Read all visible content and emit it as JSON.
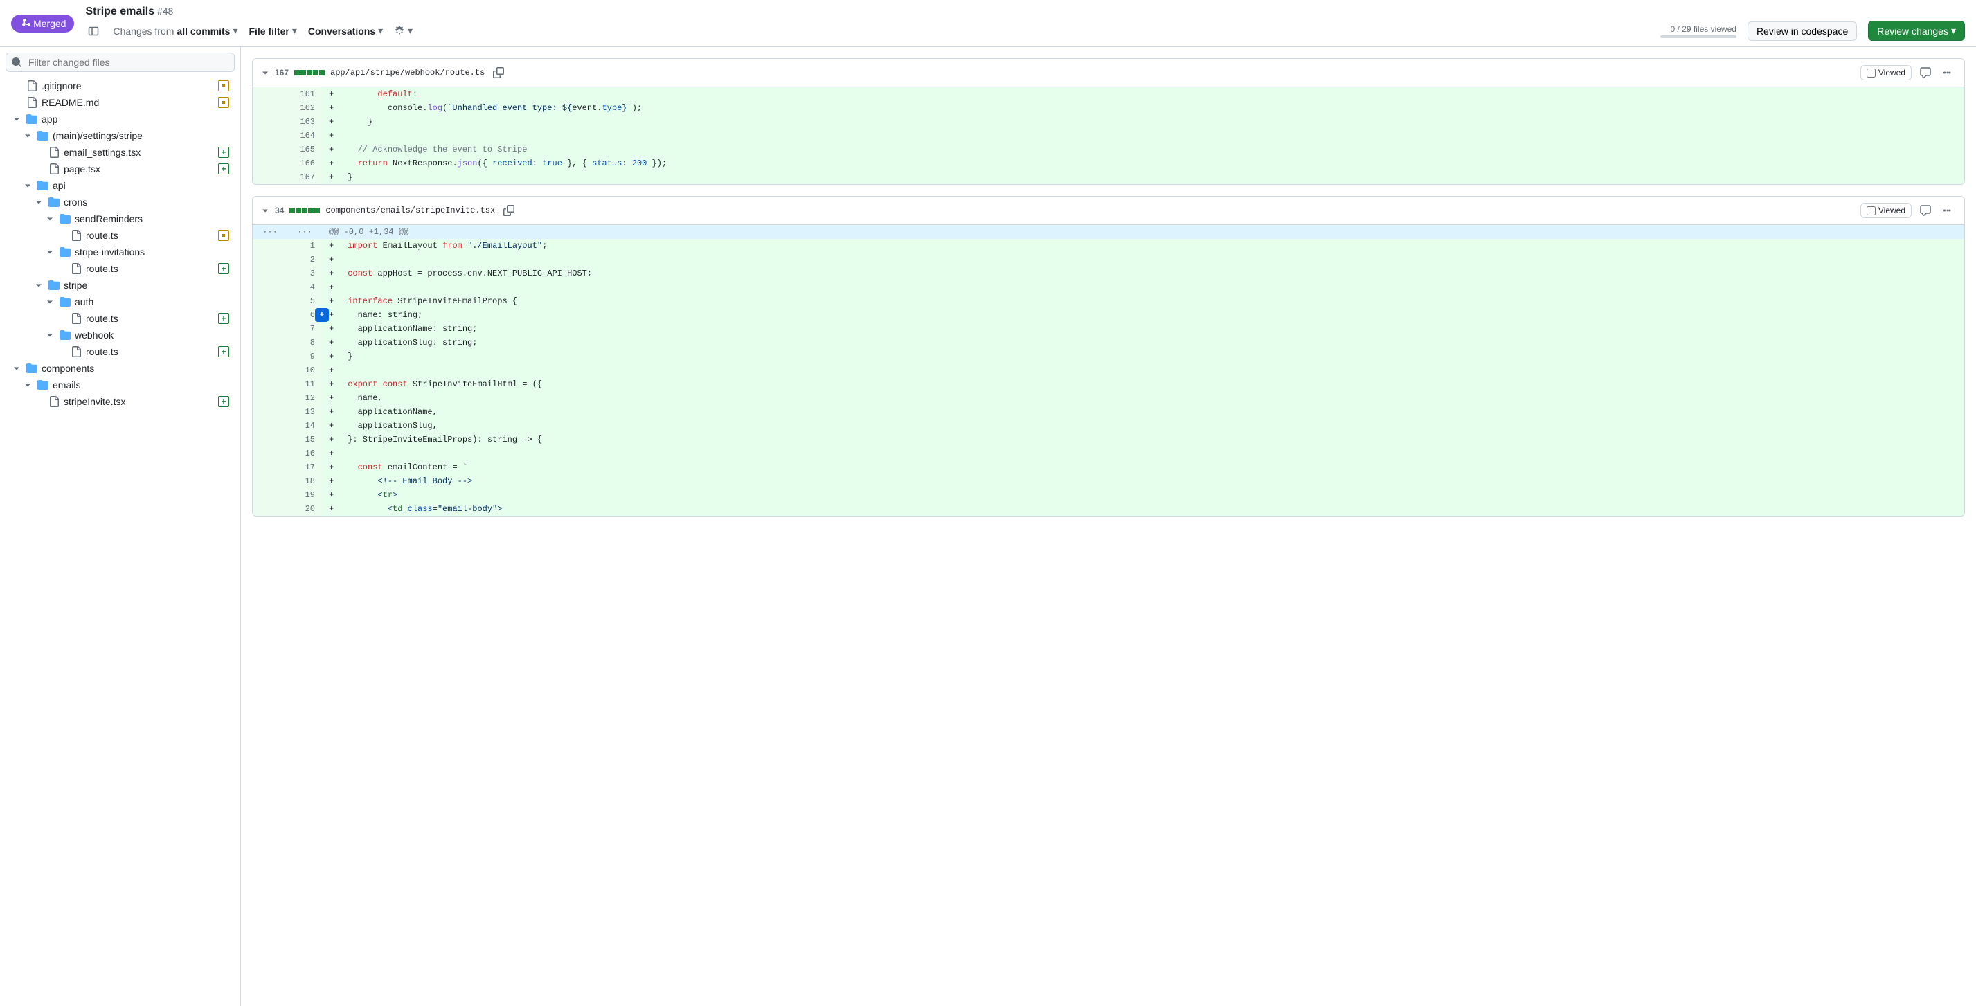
{
  "header": {
    "merged_label": "Merged",
    "pr_title": "Stripe emails",
    "pr_number": "#48",
    "changes_from_prefix": "Changes from",
    "changes_from_value": "all commits",
    "file_filter": "File filter",
    "conversations": "Conversations",
    "files_viewed": "0 / 29 files viewed",
    "review_codespace": "Review in codespace",
    "review_changes": "Review changes"
  },
  "sidebar": {
    "filter_placeholder": "Filter changed files",
    "items": [
      {
        "label": ".gitignore",
        "type": "file",
        "indent": 0,
        "status": "modified"
      },
      {
        "label": "README.md",
        "type": "file",
        "indent": 0,
        "status": "modified"
      },
      {
        "label": "app",
        "type": "folder",
        "indent": 0
      },
      {
        "label": "(main)/settings/stripe",
        "type": "folder",
        "indent": 1
      },
      {
        "label": "email_settings.tsx",
        "type": "file",
        "indent": 2,
        "status": "added"
      },
      {
        "label": "page.tsx",
        "type": "file",
        "indent": 2,
        "status": "added"
      },
      {
        "label": "api",
        "type": "folder",
        "indent": 1
      },
      {
        "label": "crons",
        "type": "folder",
        "indent": 2
      },
      {
        "label": "sendReminders",
        "type": "folder",
        "indent": 3
      },
      {
        "label": "route.ts",
        "type": "file",
        "indent": 4,
        "status": "modified"
      },
      {
        "label": "stripe-invitations",
        "type": "folder",
        "indent": 3
      },
      {
        "label": "route.ts",
        "type": "file",
        "indent": 4,
        "status": "added"
      },
      {
        "label": "stripe",
        "type": "folder",
        "indent": 2
      },
      {
        "label": "auth",
        "type": "folder",
        "indent": 3
      },
      {
        "label": "route.ts",
        "type": "file",
        "indent": 4,
        "status": "added"
      },
      {
        "label": "webhook",
        "type": "folder",
        "indent": 3
      },
      {
        "label": "route.ts",
        "type": "file",
        "indent": 4,
        "status": "added"
      },
      {
        "label": "components",
        "type": "folder",
        "indent": 0
      },
      {
        "label": "emails",
        "type": "folder",
        "indent": 1
      },
      {
        "label": "stripeInvite.tsx",
        "type": "file",
        "indent": 2,
        "status": "added"
      }
    ]
  },
  "files": [
    {
      "change_count": "167",
      "path": "app/api/stripe/webhook/route.ts",
      "viewed_label": "Viewed",
      "lines": [
        {
          "num_new": "161",
          "sign": "+",
          "html": "      <span class=\"syn-kw\">default</span>:"
        },
        {
          "num_new": "162",
          "sign": "+",
          "html": "        console.<span class=\"syn-fn\">log</span>(<span class=\"syn-str\">`Unhandled event type: ${</span>event.<span class=\"syn-prop\">type</span><span class=\"syn-str\">}`</span>);"
        },
        {
          "num_new": "163",
          "sign": "+",
          "html": "    }"
        },
        {
          "num_new": "164",
          "sign": "+",
          "html": ""
        },
        {
          "num_new": "165",
          "sign": "+",
          "html": "  <span class=\"syn-com\">// Acknowledge the event to Stripe</span>"
        },
        {
          "num_new": "166",
          "sign": "+",
          "html": "  <span class=\"syn-kw\">return</span> NextResponse.<span class=\"syn-fn\">json</span>({ <span class=\"syn-prop\">received</span>: <span class=\"syn-num\">true</span> }, { <span class=\"syn-prop\">status</span>: <span class=\"syn-num\">200</span> });"
        },
        {
          "num_new": "167",
          "sign": "+",
          "html": "}"
        }
      ]
    },
    {
      "change_count": "34",
      "path": "components/emails/stripeInvite.tsx",
      "viewed_label": "Viewed",
      "hunk": "@@ -0,0 +1,34 @@",
      "lines": [
        {
          "num_new": "1",
          "sign": "+",
          "html": "<span class=\"syn-kw\">import</span> EmailLayout <span class=\"syn-kw\">from</span> <span class=\"syn-str\">\"./EmailLayout\"</span>;"
        },
        {
          "num_new": "2",
          "sign": "+",
          "html": ""
        },
        {
          "num_new": "3",
          "sign": "+",
          "html": "<span class=\"syn-kw\">const</span> appHost = process.env.NEXT_PUBLIC_API_HOST;"
        },
        {
          "num_new": "4",
          "sign": "+",
          "html": ""
        },
        {
          "num_new": "5",
          "sign": "+",
          "html": "<span class=\"syn-kw\">interface</span> StripeInviteEmailProps {"
        },
        {
          "num_new": "6",
          "sign": "+",
          "html": "  name: string;",
          "hover": true
        },
        {
          "num_new": "7",
          "sign": "+",
          "html": "  applicationName: string;"
        },
        {
          "num_new": "8",
          "sign": "+",
          "html": "  applicationSlug: string;"
        },
        {
          "num_new": "9",
          "sign": "+",
          "html": "}"
        },
        {
          "num_new": "10",
          "sign": "+",
          "html": ""
        },
        {
          "num_new": "11",
          "sign": "+",
          "html": "<span class=\"syn-kw\">export</span> <span class=\"syn-kw\">const</span> StripeInviteEmailHtml = ({"
        },
        {
          "num_new": "12",
          "sign": "+",
          "html": "  name,"
        },
        {
          "num_new": "13",
          "sign": "+",
          "html": "  applicationName,"
        },
        {
          "num_new": "14",
          "sign": "+",
          "html": "  applicationSlug,"
        },
        {
          "num_new": "15",
          "sign": "+",
          "html": "}: StripeInviteEmailProps): string =&gt; {"
        },
        {
          "num_new": "16",
          "sign": "+",
          "html": ""
        },
        {
          "num_new": "17",
          "sign": "+",
          "html": "  <span class=\"syn-kw\">const</span> emailContent = <span class=\"syn-str\">`</span>"
        },
        {
          "num_new": "18",
          "sign": "+",
          "html": "<span class=\"syn-str\">      &lt;!-- Email Body --&gt;</span>"
        },
        {
          "num_new": "19",
          "sign": "+",
          "html": "<span class=\"syn-str\">      &lt;</span><span class=\"syn-tag\">tr</span><span class=\"syn-str\">&gt;</span>"
        },
        {
          "num_new": "20",
          "sign": "+",
          "html": "<span class=\"syn-str\">        &lt;</span><span class=\"syn-tag\">td</span> <span class=\"syn-attr\">class</span>=<span class=\"syn-val\">\"email-body\"</span><span class=\"syn-str\">&gt;</span>"
        }
      ]
    }
  ]
}
